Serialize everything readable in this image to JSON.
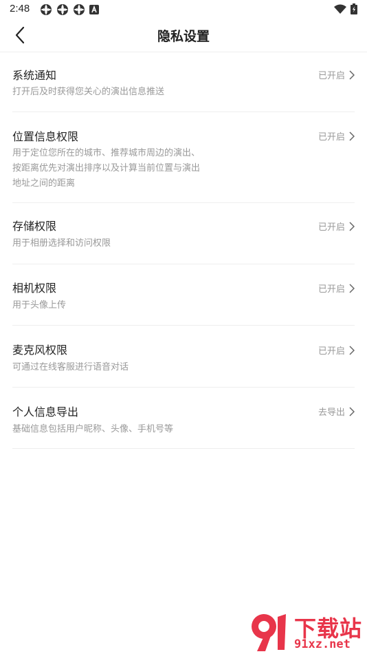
{
  "status_bar": {
    "time": "2:48",
    "left_icons": [
      "app-notification-icon",
      "app-notification-icon",
      "app-notification-icon",
      "a-badge-icon"
    ],
    "right_icons": [
      "wifi-icon",
      "battery-charging-icon"
    ]
  },
  "header": {
    "title": "隐私设置",
    "back_icon": "chevron-left-icon"
  },
  "items": [
    {
      "title": "系统通知",
      "desc": "打开后及时获得您关心的演出信息推送",
      "status": "已开启"
    },
    {
      "title": "位置信息权限",
      "desc": "用于定位您所在的城市、推荐城市周边的演出、按距离优先对演出排序以及计算当前位置与演出地址之间的距离",
      "status": "已开启"
    },
    {
      "title": "存储权限",
      "desc": "用于相册选择和访问权限",
      "status": "已开启"
    },
    {
      "title": "相机权限",
      "desc": "用于头像上传",
      "status": "已开启"
    },
    {
      "title": "麦克风权限",
      "desc": "可通过在线客服进行语音对话",
      "status": "已开启"
    },
    {
      "title": "个人信息导出",
      "desc": "基础信息包括用户昵称、头像、手机号等",
      "status": "去导出"
    }
  ],
  "watermark": {
    "brand_top": "下载站",
    "brand_bottom": "91xz.net"
  },
  "colors": {
    "text_primary": "#222222",
    "text_secondary": "#999999",
    "divider": "#eeeeee",
    "watermark": "#e8354a"
  }
}
